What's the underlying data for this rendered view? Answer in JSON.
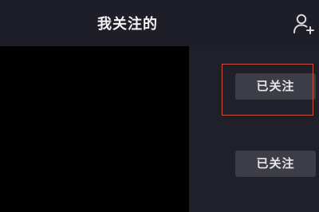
{
  "header": {
    "title": "我关注的",
    "add_user_icon": "add-user-icon"
  },
  "following_list": [
    {
      "follow_status_label": "已关注"
    },
    {
      "follow_status_label": "已关注"
    }
  ],
  "annotation": {
    "highlight_color": "#c8503f"
  },
  "colors": {
    "background": "#1f2029",
    "button": "#3c3d47",
    "video_thumbnail": "#000000"
  }
}
